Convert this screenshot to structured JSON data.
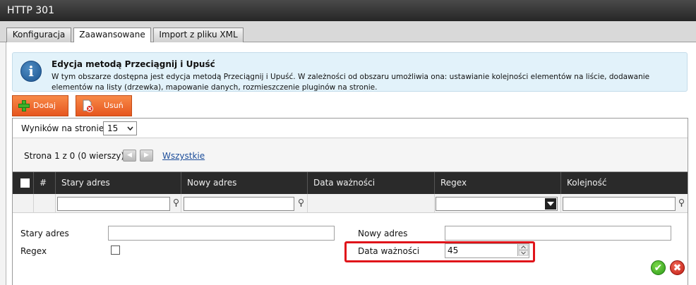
{
  "window": {
    "title": "HTTP 301"
  },
  "tabs": [
    {
      "label": "Konfiguracja"
    },
    {
      "label": "Zaawansowane",
      "active": true
    },
    {
      "label": "Import z pliku XML"
    }
  ],
  "info": {
    "title": "Edycja metodą Przeciągnij i Upuść",
    "text": "W tym obszarze dostępna jest edycja metodą Przeciągnij i Upuść. W zależności od obszaru umożliwia ona: ustawianie kolejności elementów na liście, dodawanie elementów na listy (drzewka), mapowanie danych, rozmieszczenie pluginów na stronie.",
    "icon": "info-icon"
  },
  "toolbar": {
    "add_label": "Dodaj",
    "remove_label": "Usuń",
    "accent": "#ee6a2e"
  },
  "pager": {
    "per_page_label": "Wyników na stronie:",
    "per_page_value": "15",
    "page_info": "Strona 1 z 0 (0 wierszy)",
    "prev_symbol": "◀",
    "next_symbol": "▶",
    "all_link": "Wszystkie"
  },
  "table": {
    "hash": "#",
    "columns": [
      "Stary adres",
      "Nowy adres",
      "Data ważności",
      "Regex",
      "Kolejność"
    ]
  },
  "form": {
    "old_address_label": "Stary adres",
    "old_address_value": "",
    "new_address_label": "Nowy adres",
    "new_address_value": "",
    "regex_label": "Regex",
    "regex_checked": false,
    "expiry_label": "Data ważności",
    "expiry_value": "45"
  },
  "actions": {
    "confirm": "✔",
    "cancel": "✖"
  },
  "colors": {
    "highlight": "#e0141a",
    "header_bg": "#2a2a2a",
    "info_bg": "#e2f2fa"
  }
}
